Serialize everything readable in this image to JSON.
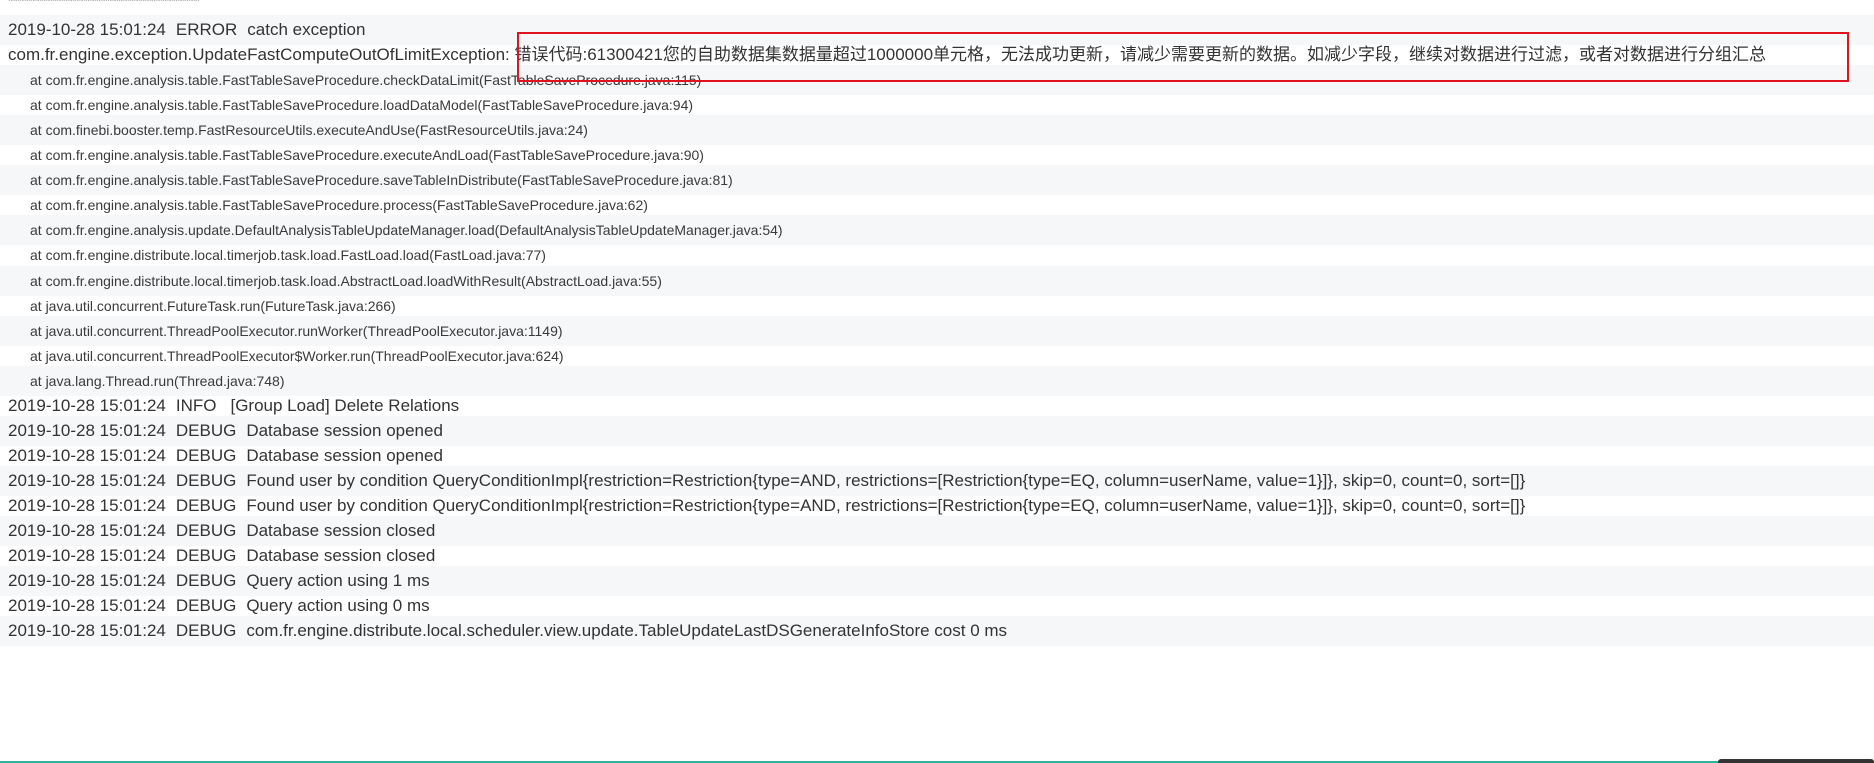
{
  "separator": "****************************************************",
  "lines": [
    {
      "timestamp": "2019-10-28 15:01:24",
      "level": "ERROR",
      "message": "catch exception"
    },
    {
      "timestamp": "",
      "level": "",
      "message": "com.fr.engine.exception.UpdateFastComputeOutOfLimitException: 错误代码:61300421您的自助数据集数据量超过1000000单元格，无法成功更新，请减少需要更新的数据。如减少字段，继续对数据进行过滤，或者对数据进行分组汇总"
    },
    {
      "trace": "at com.fr.engine.analysis.table.FastTableSaveProcedure.checkDataLimit(FastTableSaveProcedure.java:115)"
    },
    {
      "trace": "at com.fr.engine.analysis.table.FastTableSaveProcedure.loadDataModel(FastTableSaveProcedure.java:94)"
    },
    {
      "trace": "at com.finebi.booster.temp.FastResourceUtils.executeAndUse(FastResourceUtils.java:24)"
    },
    {
      "trace": "at com.fr.engine.analysis.table.FastTableSaveProcedure.executeAndLoad(FastTableSaveProcedure.java:90)"
    },
    {
      "trace": "at com.fr.engine.analysis.table.FastTableSaveProcedure.saveTableInDistribute(FastTableSaveProcedure.java:81)"
    },
    {
      "trace": "at com.fr.engine.analysis.table.FastTableSaveProcedure.process(FastTableSaveProcedure.java:62)"
    },
    {
      "trace": "at com.fr.engine.analysis.update.DefaultAnalysisTableUpdateManager.load(DefaultAnalysisTableUpdateManager.java:54)"
    },
    {
      "trace": "at com.fr.engine.distribute.local.timerjob.task.load.FastLoad.load(FastLoad.java:77)"
    },
    {
      "trace": "at com.fr.engine.distribute.local.timerjob.task.load.AbstractLoad.loadWithResult(AbstractLoad.java:55)"
    },
    {
      "trace": "at java.util.concurrent.FutureTask.run(FutureTask.java:266)"
    },
    {
      "trace": "at java.util.concurrent.ThreadPoolExecutor.runWorker(ThreadPoolExecutor.java:1149)"
    },
    {
      "trace": "at java.util.concurrent.ThreadPoolExecutor$Worker.run(ThreadPoolExecutor.java:624)"
    },
    {
      "trace": "at java.lang.Thread.run(Thread.java:748)"
    },
    {
      "timestamp": "2019-10-28 15:01:24",
      "level": "INFO",
      "message": "[Group Load] Delete Relations"
    },
    {
      "timestamp": "2019-10-28 15:01:24",
      "level": "DEBUG",
      "message": "Database session opened"
    },
    {
      "timestamp": "2019-10-28 15:01:24",
      "level": "DEBUG",
      "message": "Database session opened"
    },
    {
      "timestamp": "2019-10-28 15:01:24",
      "level": "DEBUG",
      "message": "Found user by condition QueryConditionImpl{restriction=Restriction{type=AND, restrictions=[Restriction{type=EQ, column=userName, value=1}]}, skip=0, count=0, sort=[]}"
    },
    {
      "timestamp": "2019-10-28 15:01:24",
      "level": "DEBUG",
      "message": "Found user by condition QueryConditionImpl{restriction=Restriction{type=AND, restrictions=[Restriction{type=EQ, column=userName, value=1}]}, skip=0, count=0, sort=[]}"
    },
    {
      "timestamp": "2019-10-28 15:01:24",
      "level": "DEBUG",
      "message": "Database session closed"
    },
    {
      "timestamp": "2019-10-28 15:01:24",
      "level": "DEBUG",
      "message": "Database session closed"
    },
    {
      "timestamp": "2019-10-28 15:01:24",
      "level": "DEBUG",
      "message": "Query action using 1 ms"
    },
    {
      "timestamp": "2019-10-28 15:01:24",
      "level": "DEBUG",
      "message": "Query action using 0 ms"
    },
    {
      "timestamp": "2019-10-28 15:01:24",
      "level": "DEBUG",
      "message": "com.fr.engine.distribute.local.scheduler.view.update.TableUpdateLastDSGenerateInfoStore cost 0 ms"
    }
  ],
  "colors": {
    "highlight_border": "#e0141e",
    "alt_row": "#f6f7f9",
    "bottom_accent": "#2fb4a0"
  }
}
